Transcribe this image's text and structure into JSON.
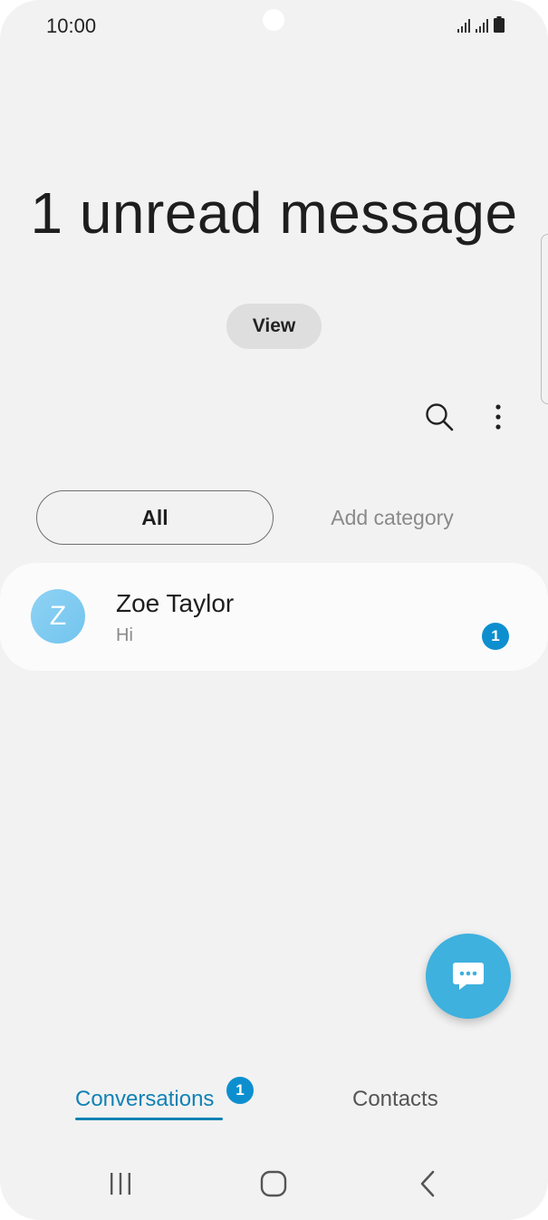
{
  "status_bar": {
    "time": "10:00",
    "icons": [
      "signal-icon",
      "signal-icon",
      "battery-icon"
    ]
  },
  "header": {
    "title": "1 unread message",
    "view_label": "View"
  },
  "toolbar": {
    "icons": [
      "search-icon",
      "more-options-icon"
    ]
  },
  "categories": {
    "selected": "All",
    "add_label": "Add category"
  },
  "conversations": [
    {
      "avatar_letter": "Z",
      "name": "Zoe Taylor",
      "preview": "Hi",
      "unread_count": "1"
    }
  ],
  "fab": {
    "icon": "new-message-icon",
    "color": "#3eb1de"
  },
  "bottom_tabs": {
    "conversations_label": "Conversations",
    "conversations_badge": "1",
    "contacts_label": "Contacts",
    "active_color": "#1182b4"
  },
  "nav_bar": {
    "icons": [
      "recent-apps-icon",
      "home-icon",
      "back-icon"
    ]
  }
}
